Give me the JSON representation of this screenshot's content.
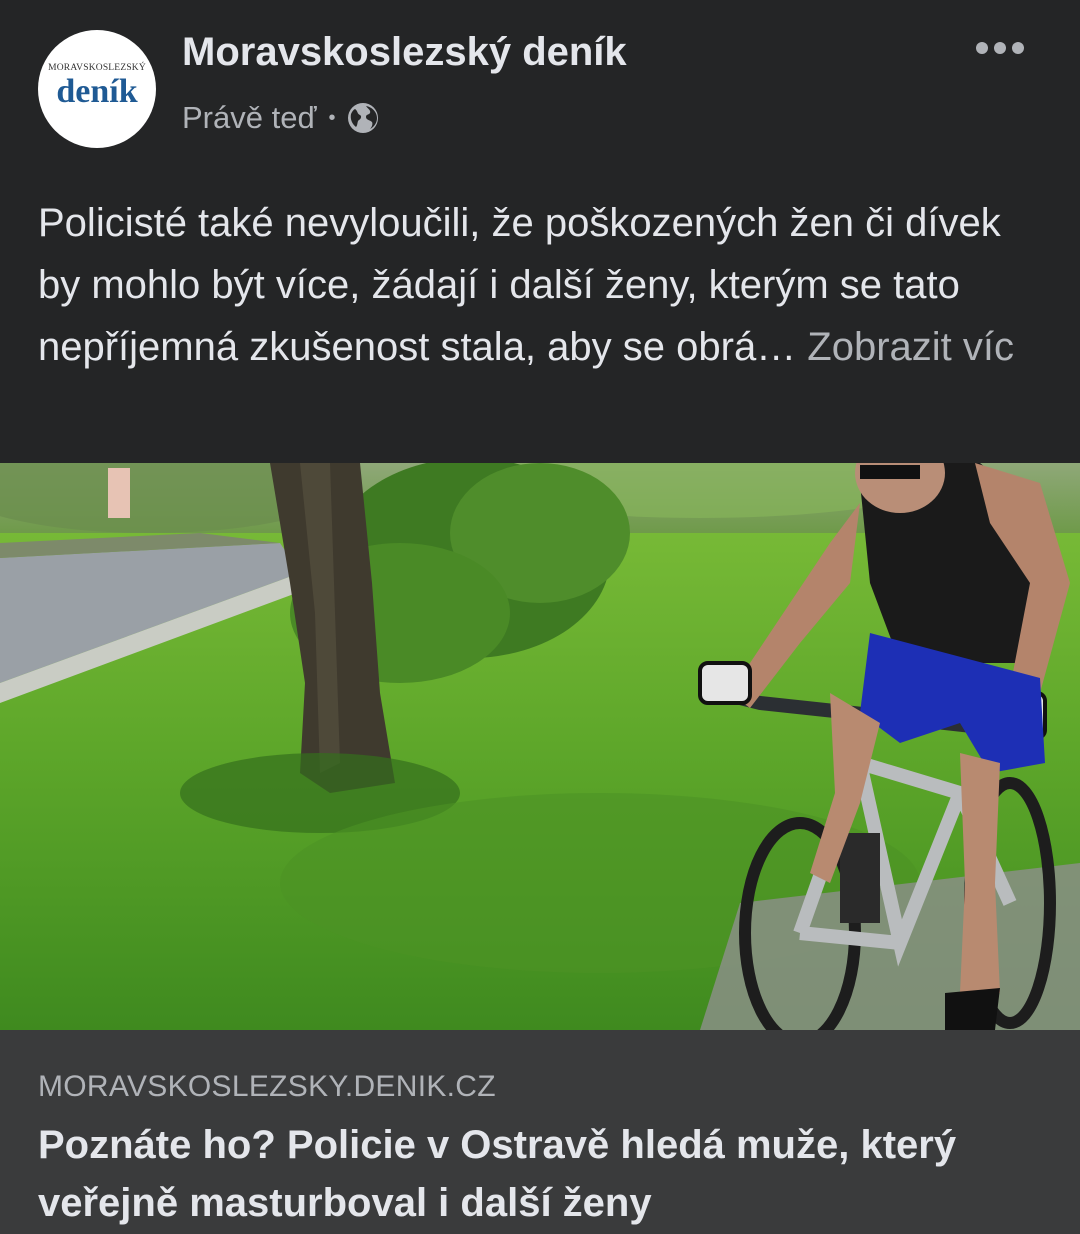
{
  "post": {
    "page_name": "Moravskoslezský deník",
    "timestamp": "Právě teď",
    "separator": "•",
    "privacy_icon": "globe-icon",
    "more_icon": "more-horizontal-icon",
    "avatar": {
      "small_text": "MORAVSKOSLEZSKÝ",
      "big_text": "deník"
    },
    "text": "Policisté také nevyloučili, že poškozených žen či dívek by mohlo být více, žádají i další ženy, kterým se tato nepříjemná zkušenost stala, aby se obrá…",
    "see_more": "Zobrazit víc"
  },
  "link_preview": {
    "domain": "MORAVSKOSLEZSKY.DENIK.CZ",
    "title": "Poznáte ho? Policie v Ostravě hledá muže, který veřejně masturboval i další ženy"
  },
  "colors": {
    "background": "#242526",
    "footer": "#3a3b3c",
    "text": "#e4e6eb",
    "secondary_text": "#b0b3b8",
    "brand_blue": "#1f5a94"
  }
}
